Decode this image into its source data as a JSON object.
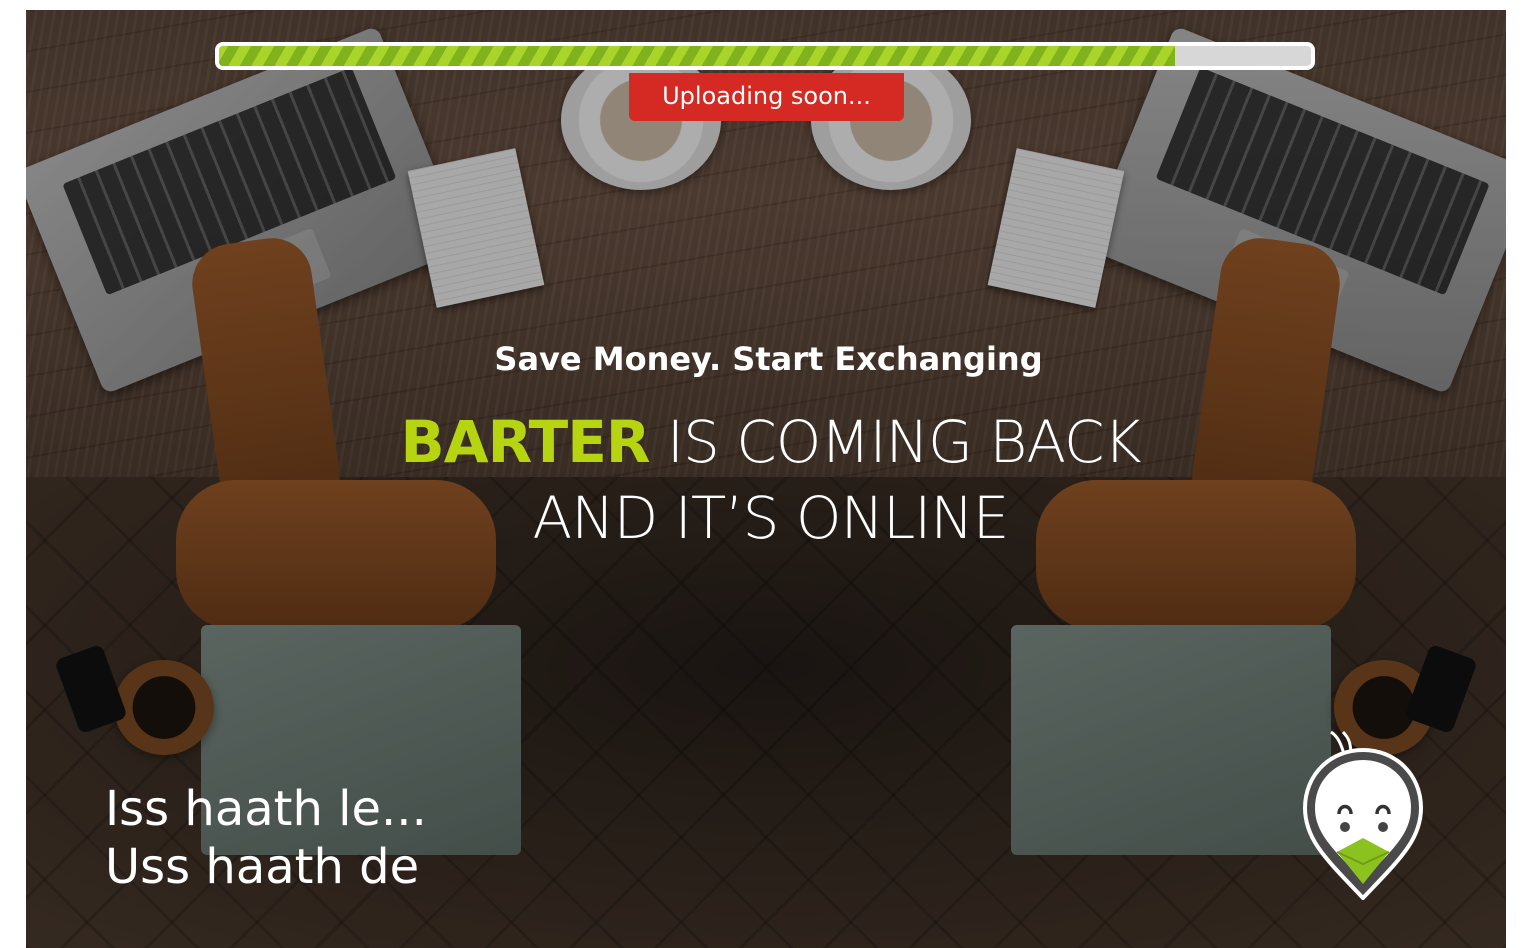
{
  "progress": {
    "percent": 87.5
  },
  "status": {
    "label": "Uploading soon..."
  },
  "hero": {
    "tagline": "Save Money. Start Exchanging",
    "brand": "BARTER",
    "headline_rest": " IS COMING BACK",
    "headline_line2": "AND IT’S ONLINE"
  },
  "slogan": {
    "line1": "Iss haath le...",
    "line2": "Uss haath de"
  },
  "colors": {
    "accent_green": "#b6d40f",
    "badge_red": "#d42a23",
    "progress_green": "#8cc21f"
  },
  "icons": {
    "mascot": "bird-mascot-icon"
  }
}
